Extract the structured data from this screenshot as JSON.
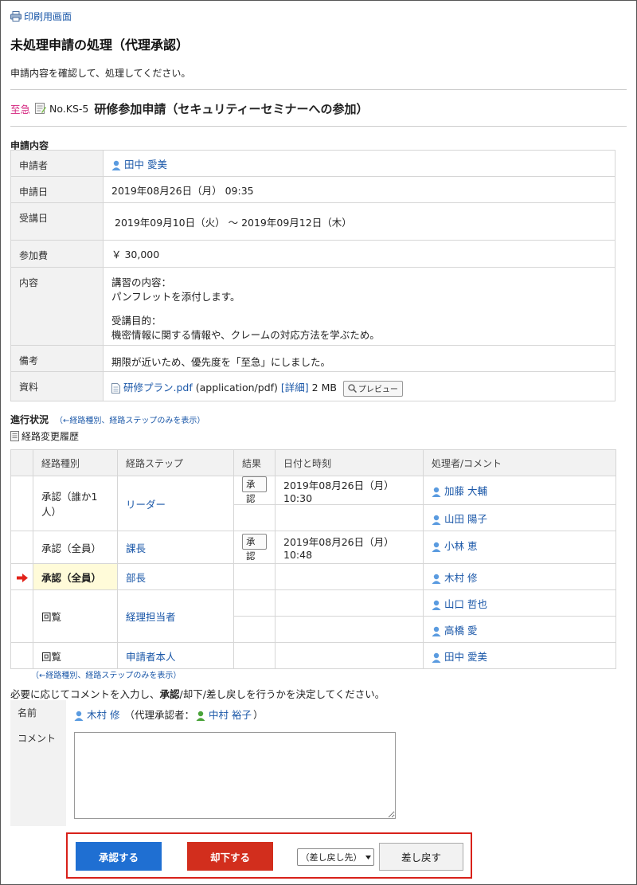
{
  "header": {
    "print_link": "印刷用画面",
    "title": "未処理申請の処理（代理承認）",
    "instruction": "申請内容を確認して、処理してください。"
  },
  "request": {
    "urgency": "至急",
    "number": "No.KS-5",
    "name": "研修参加申請（セキュリティーセミナーへの参加）"
  },
  "details": {
    "section_label": "申請内容",
    "rows": {
      "applicant": {
        "label": "申請者",
        "value": "田中 愛美"
      },
      "date": {
        "label": "申請日",
        "value": "2019年08月26日（月） 09:35"
      },
      "course_dates": {
        "label": "受講日",
        "value": "2019年09月10日（火） 〜 2019年09月12日（木）"
      },
      "fee": {
        "label": "参加費",
        "value": "￥ 30,000"
      },
      "content": {
        "label": "内容",
        "line1": "講習の内容：",
        "line2": "パンフレットを添付します。",
        "line3": "受講目的：",
        "line4": "機密情報に関する情報や、クレームの対応方法を学ぶため。"
      },
      "remarks": {
        "label": "備考",
        "value": "期限が近いため、優先度を「至急」にしました。"
      },
      "attachment": {
        "label": "資料",
        "file_name": "研修プラン.pdf",
        "mime": "(application/pdf)",
        "detail_link": "[詳細]",
        "size": "2 MB",
        "preview_button": "プレビュー"
      }
    }
  },
  "progress": {
    "label": "進行状況",
    "filter_link": "（←経路種別、経路ステップのみを表示）",
    "history_link": "経路変更履歴",
    "columns": {
      "type": "経路種別",
      "step": "経路ステップ",
      "result": "結果",
      "datetime": "日付と時刻",
      "processor": "処理者/コメント"
    },
    "steps": {
      "s1": {
        "type": "承認（誰か1人）",
        "step": "リーダー",
        "result": "承認",
        "datetime": "2019年08月26日（月） 10:30",
        "processor1": "加藤 大輔",
        "processor2": "山田 陽子"
      },
      "s2": {
        "type": "承認（全員）",
        "step": "課長",
        "result": "承認",
        "datetime": "2019年08月26日（月） 10:48",
        "processor1": "小林 恵"
      },
      "s3": {
        "type": "承認（全員）",
        "step": "部長",
        "processor1": "木村 修"
      },
      "s4": {
        "type": "回覧",
        "step": "経理担当者",
        "processor1": "山口 哲也",
        "processor2": "高橋 愛"
      },
      "s5": {
        "type": "回覧",
        "step": "申請者本人",
        "processor1": "田中 愛美"
      }
    },
    "footer_link": "（←経路種別、経路ステップのみを表示）"
  },
  "decision": {
    "prefix": "必要に応じてコメントを入力し、",
    "approve_word": "承認",
    "suffix": "/却下/差し戻しを行うかを決定してください。",
    "name_label": "名前",
    "name_value": "木村 修",
    "proxy_prefix": "（代理承認者：",
    "proxy_name": "中村 裕子",
    "proxy_suffix": "）",
    "comment_label": "コメント",
    "comment_value": ""
  },
  "actions": {
    "approve": "承認する",
    "reject": "却下する",
    "sendback_select": "（差し戻し先）",
    "sendback": "差し戻す"
  },
  "colors": {
    "accent_blue": "#1f6fd2",
    "reject_red": "#d22e1d",
    "urgent_pink": "#d4257f",
    "current_step_bg": "#fffbd9",
    "user_icon_blue": "#5a9be0",
    "proxy_icon_green": "#4aa33a"
  }
}
